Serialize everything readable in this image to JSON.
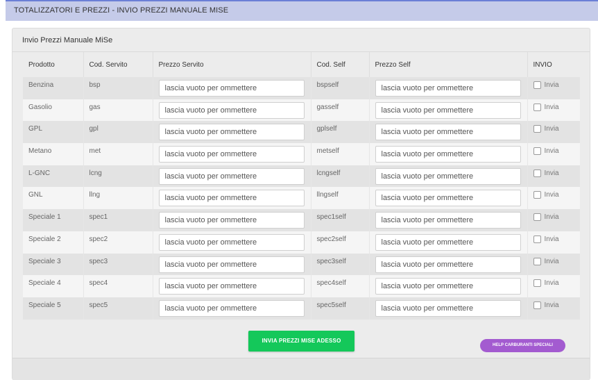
{
  "header": {
    "title": "TOTALIZZATORI E PREZZI - INVIO PREZZI MANUALE MISE"
  },
  "panel": {
    "title": "Invio Prezzi Manuale MiSe"
  },
  "table": {
    "columns": [
      "Prodotto",
      "Cod. Servito",
      "Prezzo Servito",
      "Cod. Self",
      "Prezzo Self",
      "INVIO"
    ],
    "input_placeholder": "lascia vuoto per ommettere",
    "invio_label": "Invia",
    "rows": [
      {
        "prodotto": "Benzina",
        "cod_servito": "bsp",
        "cod_self": "bspself"
      },
      {
        "prodotto": "Gasolio",
        "cod_servito": "gas",
        "cod_self": "gasself"
      },
      {
        "prodotto": "GPL",
        "cod_servito": "gpl",
        "cod_self": "gplself"
      },
      {
        "prodotto": "Metano",
        "cod_servito": "met",
        "cod_self": "metself"
      },
      {
        "prodotto": "L-GNC",
        "cod_servito": "lcng",
        "cod_self": "lcngself"
      },
      {
        "prodotto": "GNL",
        "cod_servito": "llng",
        "cod_self": "llngself"
      },
      {
        "prodotto": "Speciale 1",
        "cod_servito": "spec1",
        "cod_self": "spec1self"
      },
      {
        "prodotto": "Speciale 2",
        "cod_servito": "spec2",
        "cod_self": "spec2self"
      },
      {
        "prodotto": "Speciale 3",
        "cod_servito": "spec3",
        "cod_self": "spec3self"
      },
      {
        "prodotto": "Speciale 4",
        "cod_servito": "spec4",
        "cod_self": "spec4self"
      },
      {
        "prodotto": "Speciale 5",
        "cod_servito": "spec5",
        "cod_self": "spec5self"
      }
    ]
  },
  "actions": {
    "send_label": "INVIA PREZZI MISE ADESSO",
    "help_label": "HELP CARBURANTI SPECIALI"
  },
  "colors": {
    "header_bg": "#c5cbe9",
    "send_button": "#14c85a",
    "help_button": "#a35bd0"
  }
}
